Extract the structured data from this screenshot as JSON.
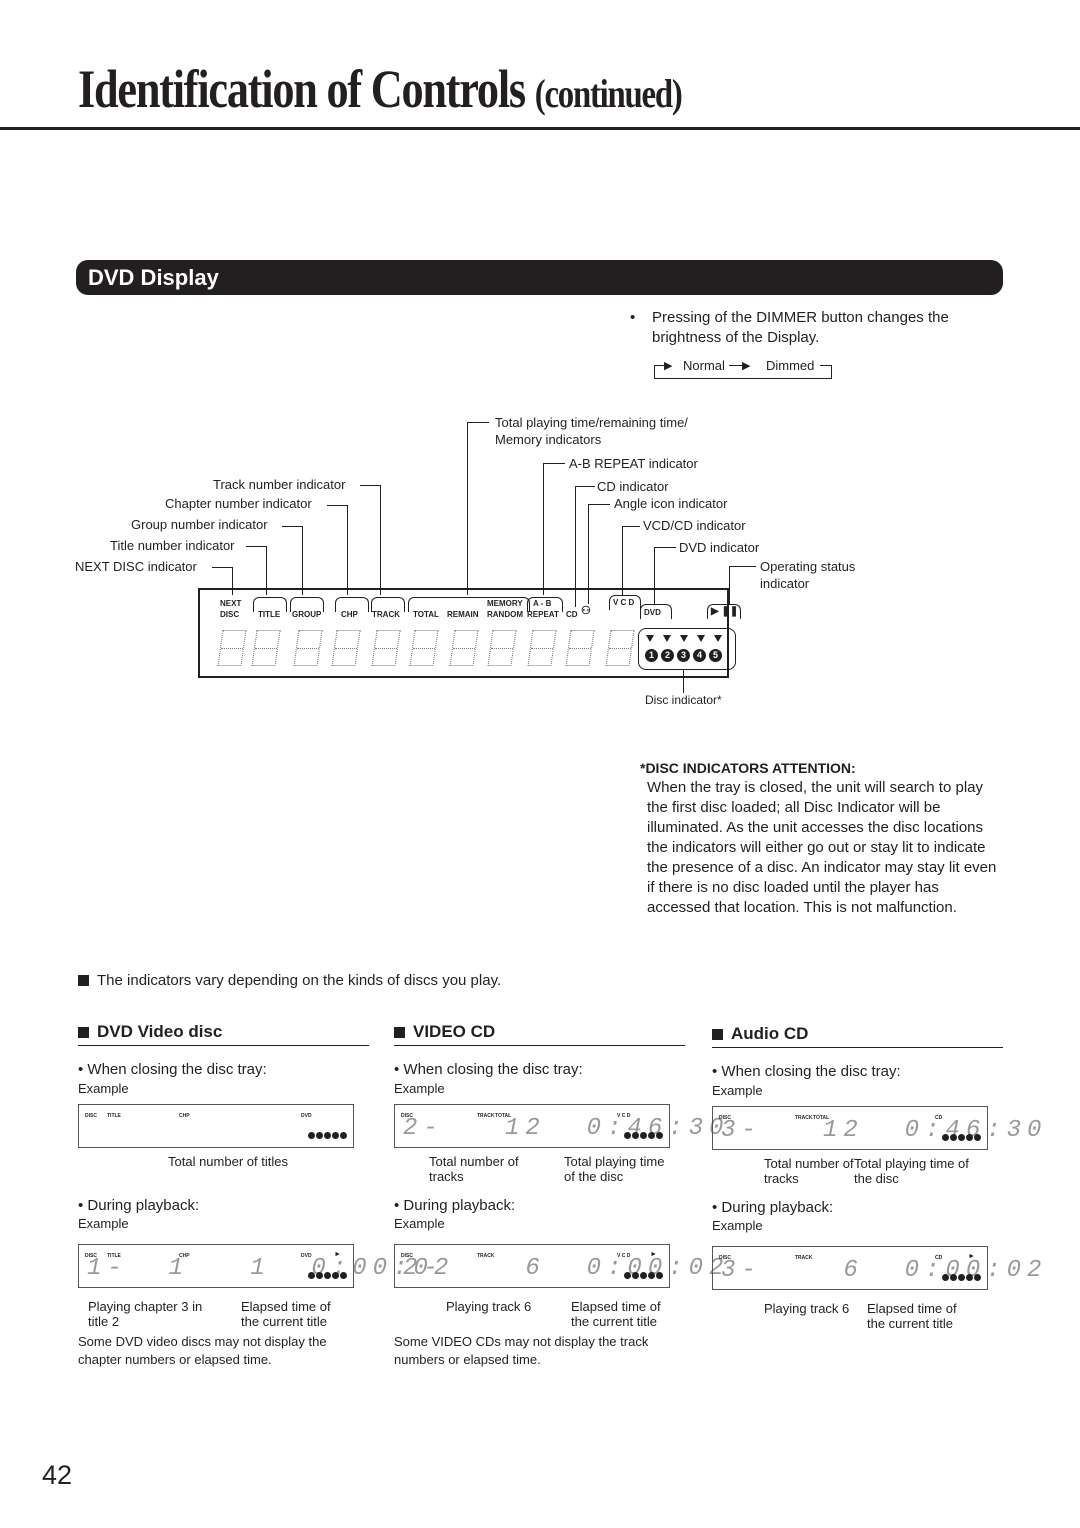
{
  "page": {
    "title": "Identification of Controls",
    "title_suffix": "(continued)",
    "section": "DVD Display",
    "page_number": "42"
  },
  "dimmer": {
    "note": "Pressing of the DIMMER button changes the brightness of the Display.",
    "cycle": [
      "Normal",
      "Dimmed"
    ]
  },
  "callouts_left": [
    "Track number indicator",
    "Chapter number indicator",
    "Group number indicator",
    "Title number indicator",
    "NEXT DISC indicator"
  ],
  "callouts_right": {
    "total_time": "Total playing time/remaining time/",
    "total_time_2": "Memory indicators",
    "ab_repeat": "A-B REPEAT indicator",
    "cd": "CD indicator",
    "angle": "Angle icon indicator",
    "vcd_cd": "VCD/CD indicator",
    "dvd": "DVD indicator",
    "operating": "Operating status",
    "operating_2": "indicator",
    "disc": "Disc indicator*"
  },
  "panel_labels": {
    "next": "NEXT",
    "disc": "DISC",
    "title": "TITLE",
    "group": "GROUP",
    "chp": "CHP",
    "track": "TRACK",
    "total": "TOTAL",
    "remain": "REMAIN",
    "memory": "MEMORY",
    "random": "RANDOM",
    "ab": "A - B",
    "repeat": "REPEAT",
    "cd": "CD",
    "vcd": "V C D",
    "dvd": "DVD",
    "play_pause": "▶ ❚❚",
    "discs": [
      "1",
      "2",
      "3",
      "4",
      "5"
    ]
  },
  "attention": {
    "heading": "*DISC INDICATORS ATTENTION:",
    "body": "When the tray is closed, the unit will search to play the first disc loaded; all Disc Indicator will be illuminated. As the unit accesses the disc locations the indicators will either go out or stay lit to indicate the presence of a disc. An indicator may stay lit even if there is no disc loaded until the player has accessed that location. This is not malfunction."
  },
  "vary_note": "The indicators vary depending on the kinds of discs you play.",
  "columns": [
    {
      "heading": "DVD Video disc",
      "closing_label": "• When closing the disc tray:",
      "example": "Example",
      "closing_display": {
        "labels": [
          "DISC",
          "TITLE",
          "CHP",
          "DVD"
        ],
        "digits": "",
        "mode": ""
      },
      "closing_caption_1": "Total number of titles",
      "closing_caption_2": "",
      "playback_label": "• During playback:",
      "playback_display": {
        "labels": [
          "DISC",
          "TITLE",
          "CHP",
          "DVD"
        ],
        "digits": "1-  1   1  0:00:02",
        "mode": "►"
      },
      "playback_caption_1": "Playing chapter 3 in title 2",
      "playback_caption_2": "Elapsed time of the current title",
      "footnote": "Some DVD video discs may not display the chapter numbers or elapsed time."
    },
    {
      "heading": "VIDEO CD",
      "closing_label": "• When closing the disc tray:",
      "example": "Example",
      "closing_display": {
        "labels": [
          "DISC",
          "TRACK",
          "TOTAL",
          "V C D"
        ],
        "digits": "2-   12  0:46:30",
        "mode": ""
      },
      "closing_caption_1": "Total number of tracks",
      "closing_caption_2": "Total playing time of the disc",
      "playback_label": "• During playback:",
      "playback_display": {
        "labels": [
          "DISC",
          "TRACK",
          "V C D"
        ],
        "digits": "2-    6  0:00:02",
        "mode": "►"
      },
      "playback_caption_1": "Playing track 6",
      "playback_caption_2": "Elapsed time of the current title",
      "footnote": "Some VIDEO CDs may not display the track numbers or elapsed time."
    },
    {
      "heading": "Audio CD",
      "closing_label": "• When closing the disc tray:",
      "example": "Example",
      "closing_display": {
        "labels": [
          "DISC",
          "TRACK",
          "TOTAL",
          "CD"
        ],
        "digits": "3-   12  0:46:30",
        "mode": ""
      },
      "closing_caption_1": "Total number of tracks",
      "closing_caption_2": "Total playing time of the disc",
      "playback_label": "• During playback:",
      "playback_display": {
        "labels": [
          "DISC",
          "TRACK",
          "CD"
        ],
        "digits": "3-    6  0:00:02",
        "mode": "►"
      },
      "playback_caption_1": "Playing track 6",
      "playback_caption_2": "Elapsed time of the current title",
      "footnote": ""
    }
  ]
}
